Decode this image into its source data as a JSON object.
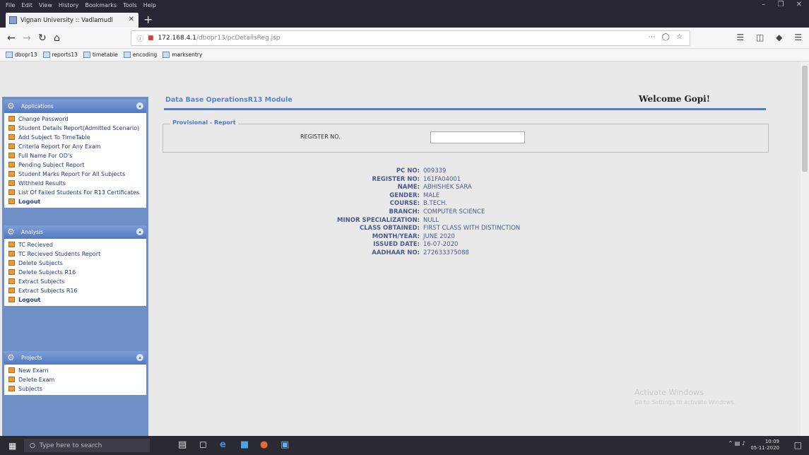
{
  "menu": [
    "File",
    "Edit",
    "View",
    "History",
    "Bookmarks",
    "Tools",
    "Help"
  ],
  "tab": {
    "title": "Vignan University :: Vadlamudi"
  },
  "url": {
    "host": "172.168.4.1",
    "path": "/dbopr13/pcDetailsReg.jsp"
  },
  "bookmarks": [
    "dbopr13",
    "reports13",
    "timetable",
    "encoding",
    "marksentry"
  ],
  "sidebar": {
    "panels": [
      {
        "title": "Applications",
        "items": [
          "Change Password",
          "Student Details Report(Admitted Scenario)",
          "Add Subject To TimeTable",
          "Criteria Report For Any Exam",
          "Full Name For OD's",
          "Pending Subject Report",
          "Student Marks Report For All Subjects",
          "Withheld Results",
          "List Of Failed Students For R13 Certificates",
          "Logout"
        ]
      },
      {
        "title": "Analysis",
        "items": [
          "TC Recieved",
          "TC Recieved Students Report",
          "Delete Subjects",
          "Delete Subjects R16",
          "Extract Subjects",
          "Extract Subjects R16",
          "Logout"
        ]
      },
      {
        "title": "Projects",
        "items": [
          "New Exam",
          "Delete Exam",
          "Subjects"
        ]
      }
    ]
  },
  "main": {
    "module_title": "Data Base OperationsR13 Module",
    "welcome": "Welcome Gopi!",
    "section_legend": "Provisional - Report",
    "register_label": "REGISTER NO.",
    "register_value": ""
  },
  "details": [
    {
      "label": "PC NO:",
      "value": "009339"
    },
    {
      "label": "REGISTER NO:",
      "value": "161FA04001"
    },
    {
      "label": "NAME:",
      "value": "ABHISHEK SARA"
    },
    {
      "label": "GENDER:",
      "value": "MALE"
    },
    {
      "label": "COURSE:",
      "value": "B.TECH."
    },
    {
      "label": "BRANCH:",
      "value": "COMPUTER SCIENCE"
    },
    {
      "label": "MINOR SPECIALIZATION:",
      "value": "NULL"
    },
    {
      "label": "CLASS OBTAINED:",
      "value": "FIRST CLASS WITH DISTINCTION"
    },
    {
      "label": "MONTH/YEAR:",
      "value": "JUNE 2020"
    },
    {
      "label": "ISSUED DATE:",
      "value": "16-07-2020"
    },
    {
      "label": "AADHAAR NO:",
      "value": "272633375088"
    }
  ],
  "watermark": {
    "line1": "Activate Windows",
    "line2": "Go to Settings to activate Windows."
  },
  "taskbar": {
    "search_placeholder": "Type here to search",
    "time": "10:09",
    "date": "05-11-2020"
  }
}
